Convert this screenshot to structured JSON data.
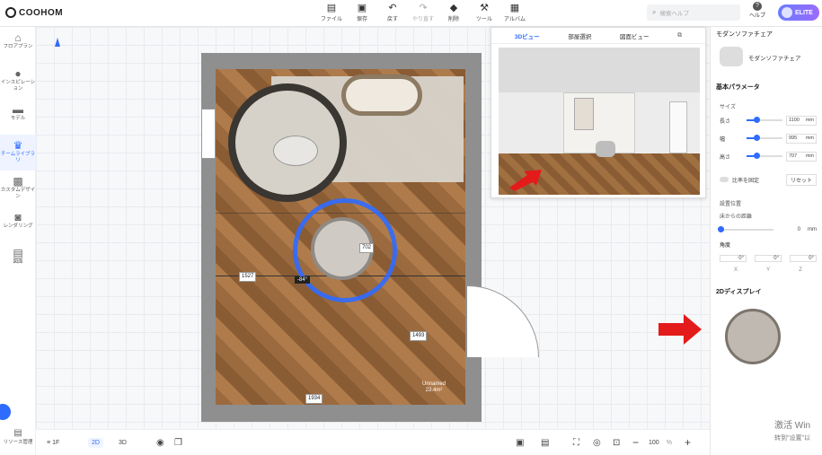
{
  "app": {
    "logo_text": "COOHOM"
  },
  "toolbar": {
    "items": [
      {
        "label": "ファイル",
        "icon": "file-icon"
      },
      {
        "label": "保存",
        "icon": "save-icon"
      },
      {
        "label": "戻す",
        "icon": "undo-icon"
      },
      {
        "label": "やり直す",
        "icon": "redo-icon"
      },
      {
        "label": "削除",
        "icon": "eraser-icon"
      },
      {
        "label": "ツール",
        "icon": "wrench-icon"
      },
      {
        "label": "アルバム",
        "icon": "album-icon"
      }
    ]
  },
  "search": {
    "placeholder": "検索ヘルプ"
  },
  "help": {
    "label": "ヘルプ"
  },
  "account": {
    "badge": "ELITE"
  },
  "sidebar": {
    "items": [
      {
        "label": "フロアプラン",
        "icon": "floorplan-icon"
      },
      {
        "label": "インスピレーション",
        "icon": "bulb-icon"
      },
      {
        "label": "モデル",
        "icon": "model-icon"
      },
      {
        "label": "チームライブラリ",
        "icon": "crown-icon",
        "active": true
      },
      {
        "label": "カスタムデザイン",
        "icon": "custom-icon"
      },
      {
        "label": "レンダリング",
        "icon": "camera-icon"
      },
      {
        "label": "図面",
        "icon": "drawing-icon"
      },
      {
        "label": "リソース管理",
        "icon": "resource-icon"
      }
    ]
  },
  "canvas": {
    "dims": {
      "d1": "702",
      "d2": "1527",
      "d3": "1493",
      "d4": "1934"
    },
    "angle": "-84°",
    "room_label_line1": "Unnamed",
    "room_label_line2": "23.4m²"
  },
  "preview": {
    "tabs": [
      "3Dビュー",
      "部屋選択",
      "図面ビュー"
    ],
    "active_tab": "3Dビュー"
  },
  "props": {
    "title": "モダンソファチェア",
    "item_name": "モダンソファチェア",
    "basic_params": "基本パラメータ",
    "size_section": "サイズ",
    "rows": [
      {
        "label": "長さ",
        "value": "1100",
        "unit": "mm"
      },
      {
        "label": "幅",
        "value": "995",
        "unit": "mm"
      },
      {
        "label": "高さ",
        "value": "707",
        "unit": "mm"
      }
    ],
    "lock_ratio": "比率を固定",
    "reset": "リセット",
    "position_section": "設置位置",
    "floor_height_label": "床からの距離",
    "floor_height_value": "0",
    "floor_height_unit": "mm",
    "angle_section": "角度",
    "angles": [
      {
        "axis": "X",
        "value": "0°"
      },
      {
        "axis": "Y",
        "value": "0°"
      },
      {
        "axis": "Z",
        "value": "0°"
      }
    ],
    "display_2d": "2Dディスプレイ"
  },
  "bottom": {
    "floor": "1F",
    "mode2d": "2D",
    "mode3d": "3D",
    "zoom": "100",
    "zoom_unit": "%"
  },
  "watermark": {
    "line1": "激活 Win",
    "line2": "转到\"设置\"以"
  },
  "colors": {
    "accent": "#2f6bff",
    "elite": "#7a6cff"
  }
}
